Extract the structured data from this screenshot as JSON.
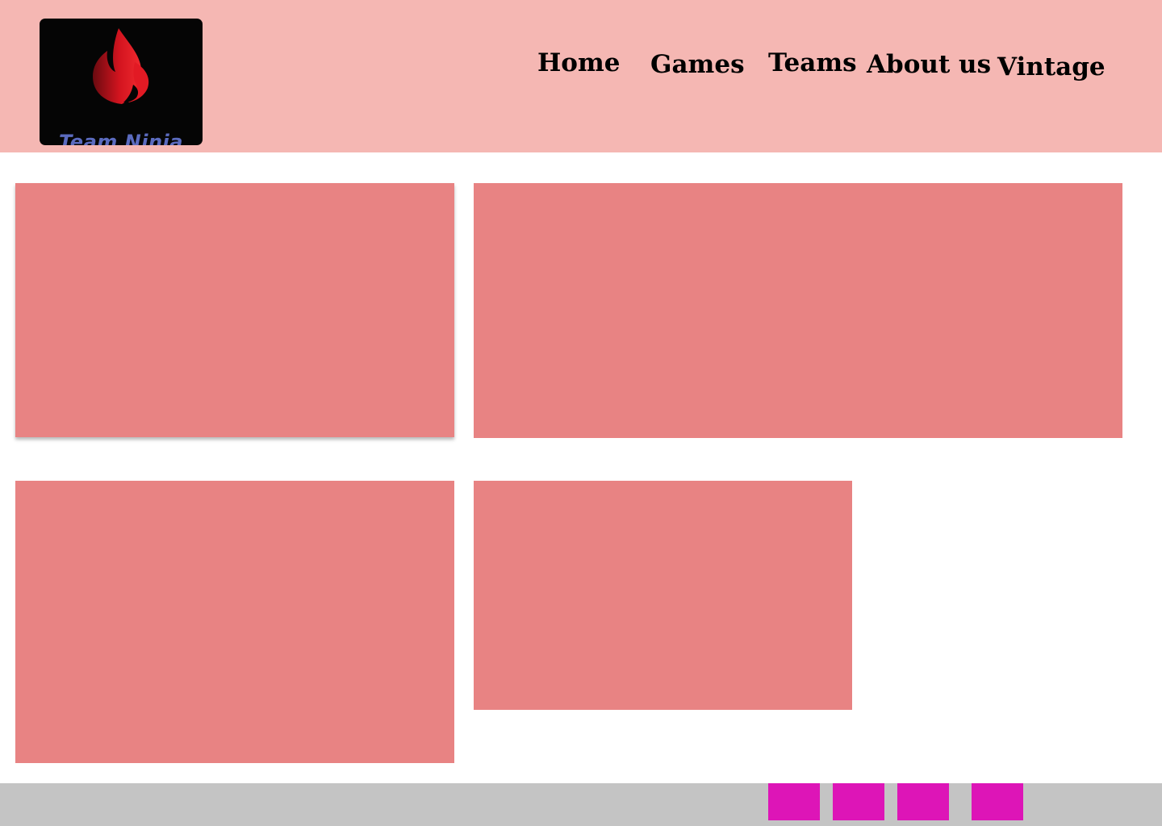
{
  "colors": {
    "header_bg": "#f5b7b3",
    "card_bg": "#e88383",
    "footer_bg": "#c4c4c4",
    "social_button_bg": "#dd15b7",
    "logo_bg": "#050505",
    "logo_flame": "#e01b24",
    "logo_text": "#5b6bbf"
  },
  "header": {
    "logo": {
      "text": "Team Ninja",
      "icon": "flame-icon"
    },
    "nav": {
      "home": "Home",
      "games": "Games",
      "teams": "Teams",
      "about": "About us",
      "vintage": "Vintage"
    }
  },
  "footer": {
    "social_buttons": [
      "social-button-1",
      "social-button-2",
      "social-button-3",
      "social-button-4"
    ]
  }
}
